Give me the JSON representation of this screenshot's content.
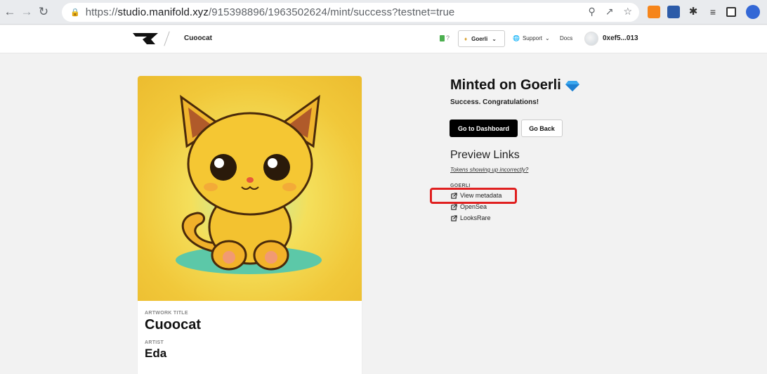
{
  "browser": {
    "url_prefix": "https://",
    "url_host": "studio.manifold.xyz",
    "url_path": "/915398896/1963502624/mint/success?testnet=true"
  },
  "header": {
    "breadcrumb": "Cuoocat",
    "gas_label": "?",
    "network_select": "Goerli",
    "support_label": "Support",
    "docs_label": "Docs",
    "wallet_address": "0xef5...013"
  },
  "artwork": {
    "title_label": "ARTWORK TITLE",
    "title": "Cuoocat",
    "artist_label": "ARTIST",
    "artist": "Eda"
  },
  "mint": {
    "title": "Minted on Goerli",
    "subtitle": "Success. Congratulations!",
    "dashboard_button": "Go to Dashboard",
    "back_button": "Go Back",
    "preview_title": "Preview Links",
    "tokens_link": "Tokens showing up incorrectly?",
    "network_label": "GOERLI",
    "links": [
      "View metadata",
      "OpenSea",
      "LooksRare"
    ]
  }
}
